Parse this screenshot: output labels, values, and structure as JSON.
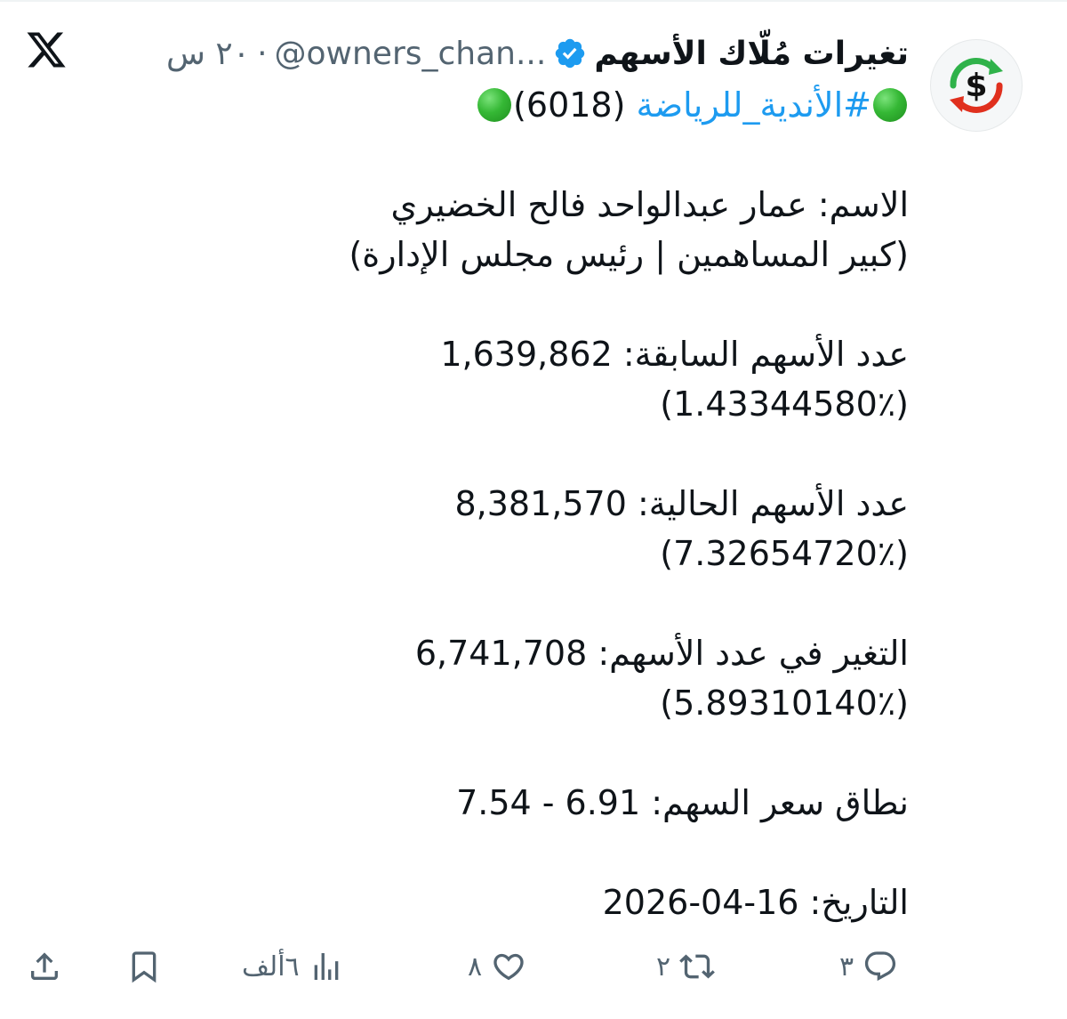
{
  "tweet": {
    "display_name": "تغيرات مُلّاك الأسهم",
    "handle": "@owners_chan...",
    "dot": "·",
    "time": "٢٠ س",
    "hashtag": "#الأندية_للرياضة",
    "code": "(6018)",
    "lines": [
      "الاسم: عمار عبدالواحد فالح الخضيري",
      "(كبير المساهمين | رئيس مجلس الإدارة)",
      "عدد الأسهم السابقة: 1,639,862",
      "(1.43344580٪)",
      "عدد الأسهم الحالية: 8,381,570",
      "(7.32654720٪)",
      "التغير في عدد الأسهم: 6,741,708",
      "(5.89310140٪)",
      "نطاق سعر السهم: 6.91 - 7.54",
      "التاريخ: 16-04-2026"
    ]
  },
  "actions": {
    "replies": "٣",
    "retweets": "٢",
    "likes": "٨",
    "views": "٦ألف"
  },
  "icons": {
    "logo": "x-logo-icon",
    "verified": "verified-badge-icon",
    "reply": "reply-icon",
    "retweet": "retweet-icon",
    "like": "heart-icon",
    "views": "views-icon",
    "bookmark": "bookmark-icon",
    "share": "share-icon"
  },
  "colors": {
    "accent": "#1d9bf0",
    "muted": "#536471",
    "green_dot": "#35b835",
    "avatar_red": "#e0301e",
    "avatar_green": "#2fb24a"
  }
}
